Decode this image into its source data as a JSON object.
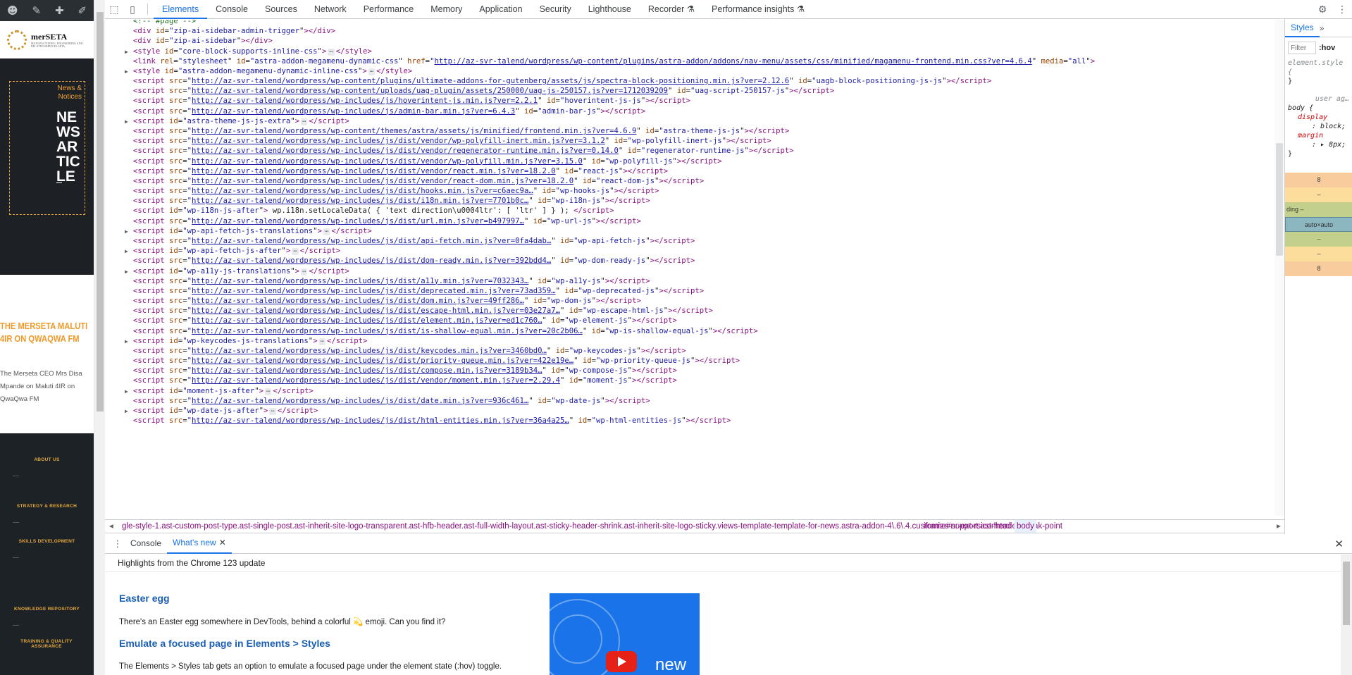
{
  "site": {
    "strip_icons": [
      "palette-icon",
      "brush-icon",
      "plus-icon",
      "pen-icon"
    ],
    "logo_text": "merSETA",
    "logo_sub": "MANUFACTURING, ENGINEERING AND RELATED SERVICES SETA",
    "news_tag": "News & Notices",
    "news_big": "NEWS ARTICLE",
    "headline": "THE MERSETA MALUTI 4IR ON QWAQWA FM",
    "blurb": "The Merseta CEO Mrs Disa Mpande on Maluti 4IR on QwaQwa FM",
    "menu": [
      "ABOUT US",
      "STRATEGY & RESEARCH",
      "SKILLS DEVELOPMENT",
      "KNOWLEDGE REPOSITORY",
      "TRAINING & QUALITY ASSURANCE"
    ]
  },
  "toolbar": {
    "tabs": [
      "Elements",
      "Console",
      "Sources",
      "Network",
      "Performance",
      "Memory",
      "Application",
      "Security",
      "Lighthouse",
      "Recorder ⚗",
      "Performance insights ⚗"
    ],
    "active": "Elements"
  },
  "code_lines": [
    {
      "t": "comment",
      "text": "<!-- #page -->"
    },
    {
      "t": "el",
      "arrow": false,
      "html": "<div id=\"zip-ai-sidebar-admin-trigger\"></div>"
    },
    {
      "t": "el",
      "arrow": false,
      "html": "<div id=\"zip-ai-sidebar\"></div>"
    },
    {
      "t": "style",
      "arrow": true,
      "id": "core-block-supports-inline-css"
    },
    {
      "t": "link",
      "id": "astra-addon-megamenu-dynamic-css",
      "href": "http://az-svr-talend/wordpress/wp-content/plugins/astra-addon/addons/nav-menu/assets/css/minified/magamenu-frontend.min.css?ver=4.6.4"
    },
    {
      "t": "style",
      "arrow": true,
      "id": "astra-addon-megamenu-dynamic-inline-css"
    },
    {
      "t": "src",
      "src": "http://az-svr-talend/wordpress/wp-content/plugins/ultimate-addons-for-gutenberg/assets/js/spectra-block-positioning.min.js?ver=2.12.6",
      "id": "uagb-block-positioning-js-js"
    },
    {
      "t": "src",
      "src": "http://az-svr-talend/wordpress/wp-content/uploads/uag-plugin/assets/250000/uag-js-250157.js?ver=1712039209",
      "id": "uag-script-250157-js"
    },
    {
      "t": "src",
      "src": "http://az-svr-talend/wordpress/wp-includes/js/hoverintent-js.min.js?ver=2.2.1",
      "id": "hoverintent-js-js"
    },
    {
      "t": "src",
      "src": "http://az-svr-talend/wordpress/wp-includes/js/admin-bar.min.js?ver=6.4.3",
      "id": "admin-bar-js"
    },
    {
      "t": "inl",
      "id": "astra-theme-js-js-extra"
    },
    {
      "t": "src",
      "src": "http://az-svr-talend/wordpress/wp-content/themes/astra/assets/js/minified/frontend.min.js?ver=4.6.9",
      "id": "astra-theme-js-js"
    },
    {
      "t": "src",
      "src": "http://az-svr-talend/wordpress/wp-includes/js/dist/vendor/wp-polyfill-inert.min.js?ver=3.1.2",
      "id": "wp-polyfill-inert-js"
    },
    {
      "t": "src",
      "src": "http://az-svr-talend/wordpress/wp-includes/js/dist/vendor/regenerator-runtime.min.js?ver=0.14.0",
      "id": "regenerator-runtime-js"
    },
    {
      "t": "src",
      "src": "http://az-svr-talend/wordpress/wp-includes/js/dist/vendor/wp-polyfill.min.js?ver=3.15.0",
      "id": "wp-polyfill-js"
    },
    {
      "t": "src",
      "src": "http://az-svr-talend/wordpress/wp-includes/js/dist/vendor/react.min.js?ver=18.2.0",
      "id": "react-js"
    },
    {
      "t": "src",
      "src": "http://az-svr-talend/wordpress/wp-includes/js/dist/vendor/react-dom.min.js?ver=18.2.0",
      "id": "react-dom-js"
    },
    {
      "t": "src",
      "src": "http://az-svr-talend/wordpress/wp-includes/js/dist/hooks.min.js?ver=c6aec9a…",
      "id": "wp-hooks-js"
    },
    {
      "t": "src",
      "src": "http://az-svr-talend/wordpress/wp-includes/js/dist/i18n.min.js?ver=7701b0c…",
      "id": "wp-i18n-js"
    },
    {
      "t": "text",
      "id": "wp-i18n-js-after",
      "body": " wp.i18n.setLocaleData( { 'text direction\\u0004ltr': [ 'ltr' ] } ); "
    },
    {
      "t": "src",
      "src": "http://az-svr-talend/wordpress/wp-includes/js/dist/url.min.js?ver=b497997…",
      "id": "wp-url-js"
    },
    {
      "t": "inl",
      "id": "wp-api-fetch-js-translations"
    },
    {
      "t": "src",
      "src": "http://az-svr-talend/wordpress/wp-includes/js/dist/api-fetch.min.js?ver=0fa4dab…",
      "id": "wp-api-fetch-js"
    },
    {
      "t": "inl",
      "id": "wp-api-fetch-js-after"
    },
    {
      "t": "src",
      "src": "http://az-svr-talend/wordpress/wp-includes/js/dist/dom-ready.min.js?ver=392bdd4…",
      "id": "wp-dom-ready-js"
    },
    {
      "t": "inl",
      "id": "wp-a11y-js-translations"
    },
    {
      "t": "src",
      "src": "http://az-svr-talend/wordpress/wp-includes/js/dist/a11y.min.js?ver=7032343…",
      "id": "wp-a11y-js"
    },
    {
      "t": "src",
      "src": "http://az-svr-talend/wordpress/wp-includes/js/dist/deprecated.min.js?ver=73ad359…",
      "id": "wp-deprecated-js"
    },
    {
      "t": "src",
      "src": "http://az-svr-talend/wordpress/wp-includes/js/dist/dom.min.js?ver=49ff286…",
      "id": "wp-dom-js"
    },
    {
      "t": "src",
      "src": "http://az-svr-talend/wordpress/wp-includes/js/dist/escape-html.min.js?ver=03e27a7…",
      "id": "wp-escape-html-js"
    },
    {
      "t": "src",
      "src": "http://az-svr-talend/wordpress/wp-includes/js/dist/element.min.js?ver=ed1c760…",
      "id": "wp-element-js"
    },
    {
      "t": "src",
      "src": "http://az-svr-talend/wordpress/wp-includes/js/dist/is-shallow-equal.min.js?ver=20c2b06…",
      "id": "wp-is-shallow-equal-js"
    },
    {
      "t": "inl",
      "id": "wp-keycodes-js-translations"
    },
    {
      "t": "src",
      "src": "http://az-svr-talend/wordpress/wp-includes/js/dist/keycodes.min.js?ver=3460bd0…",
      "id": "wp-keycodes-js"
    },
    {
      "t": "src",
      "src": "http://az-svr-talend/wordpress/wp-includes/js/dist/priority-queue.min.js?ver=422e19e…",
      "id": "wp-priority-queue-js"
    },
    {
      "t": "src",
      "src": "http://az-svr-talend/wordpress/wp-includes/js/dist/compose.min.js?ver=3189b34…",
      "id": "wp-compose-js"
    },
    {
      "t": "src",
      "src": "http://az-svr-talend/wordpress/wp-includes/js/dist/vendor/moment.min.js?ver=2.29.4",
      "id": "moment-js"
    },
    {
      "t": "inl",
      "id": "moment-js-after"
    },
    {
      "t": "src",
      "src": "http://az-svr-talend/wordpress/wp-includes/js/dist/date.min.js?ver=936c461…",
      "id": "wp-date-js"
    },
    {
      "t": "inl",
      "id": "wp-date-js-after"
    },
    {
      "t": "src",
      "src": "http://az-svr-talend/wordpress/wp-includes/js/dist/html-entities.min.js?ver=36a4a25…",
      "id": "wp-html-entities-js"
    }
  ],
  "crumbs": {
    "long": "gle-style-1.ast-custom-post-type.ast-single-post.ast-inherit-site-logo-transparent.ast-hfb-header.ast-full-width-layout.ast-sticky-header-shrink.ast-inherit-site-logo-sticky.views-template-template-for-news.astra-addon-4\\.6\\.4.customize-support.ast-header-break-point",
    "iframe": "iframe#nr-ext-rsicon",
    "html": "html",
    "body": "body"
  },
  "styles": {
    "tab": "Styles",
    "filter_placeholder": "Filter",
    "hov": ":hov",
    "element_style": "element.style {",
    "close_brace": "}",
    "ua": "user ag…",
    "body_sel": "body {",
    "p1": "display",
    "v1": "block;",
    "p2": "margin",
    "v2": "8px;",
    "box": [
      "8",
      "–",
      "ding  –",
      "auto×auto",
      "–",
      "–",
      "8"
    ]
  },
  "drawer": {
    "tabs": [
      "Console",
      "What's new"
    ],
    "active": "What's new",
    "highlights": "Highlights from the Chrome 123 update",
    "h1": "Easter egg",
    "p1": "There's an Easter egg somewhere in DevTools, behind a colorful 💫 emoji. Can you find it?",
    "h2": "Emulate a focused page in Elements > Styles",
    "p2": "The Elements > Styles tab gets an option to emulate a focused page under the element state (:hov) toggle.",
    "video_label": "new"
  }
}
